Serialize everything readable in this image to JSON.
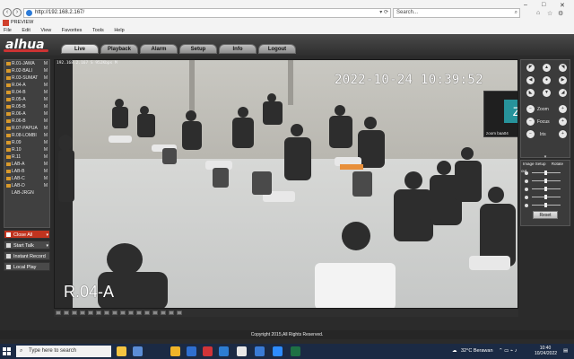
{
  "browser": {
    "address": "http://192.168.2.167/",
    "search_placeholder": "Search...",
    "tab_title": "PREVIEW",
    "menu": [
      "File",
      "Edit",
      "View",
      "Favorites",
      "Tools",
      "Help"
    ]
  },
  "app": {
    "logo": "alhua",
    "tabs": [
      {
        "label": "Live",
        "active": true
      },
      {
        "label": "Playback",
        "active": false
      },
      {
        "label": "Alarm",
        "active": false
      },
      {
        "label": "Setup",
        "active": false
      },
      {
        "label": "Info",
        "active": false
      },
      {
        "label": "Logout",
        "active": false
      }
    ]
  },
  "camera_list": [
    {
      "name": "R.01-JAWA",
      "status": "M"
    },
    {
      "name": "R.02-BALI",
      "status": "M"
    },
    {
      "name": "R.03-SUMAT",
      "status": "M"
    },
    {
      "name": "R.04-A",
      "status": "M"
    },
    {
      "name": "R.04-B",
      "status": "M"
    },
    {
      "name": "R.05-A",
      "status": "M"
    },
    {
      "name": "R.05-B",
      "status": "M"
    },
    {
      "name": "R.06-A",
      "status": "M"
    },
    {
      "name": "R.06-B",
      "status": "M"
    },
    {
      "name": "R.07-PAPUA",
      "status": "M"
    },
    {
      "name": "R.08-LOMBI",
      "status": "M"
    },
    {
      "name": "R.09",
      "status": "M"
    },
    {
      "name": "R.10",
      "status": "M"
    },
    {
      "name": "R.11",
      "status": "M"
    },
    {
      "name": "LAB-A",
      "status": "M"
    },
    {
      "name": "LAB-B",
      "status": "M"
    },
    {
      "name": "LAB-C",
      "status": "M"
    },
    {
      "name": "LAB-D",
      "status": "M"
    },
    {
      "name": "LAB-JRGN",
      "status": ""
    }
  ],
  "side_buttons": {
    "close_all": "Close All",
    "start_talk": "Start Talk",
    "instant_record": "Instant Record",
    "local_play": "Local Play"
  },
  "video": {
    "stream_info": "192.168.2.167 S 952Kbps M",
    "timestamp": "2022-10-24 10:39:52",
    "camera_name": "R.04-A",
    "zoom_tile_letter": "Z",
    "zoom_name": "zoom baa04"
  },
  "ptz": {
    "zoom_label": "Zoom",
    "focus_label": "Focus",
    "iris_label": "Iris"
  },
  "image_setup": {
    "tab_image": "Image Setup",
    "tab_rotate": "Rotate out",
    "reset_label": "Reset"
  },
  "footer": {
    "copyright": "Copyright 2015,All Rights Reserved."
  },
  "taskbar": {
    "search_placeholder": "Type here to search",
    "weather": "32°C  Berawan",
    "time": "10:40",
    "date": "10/24/2022"
  }
}
